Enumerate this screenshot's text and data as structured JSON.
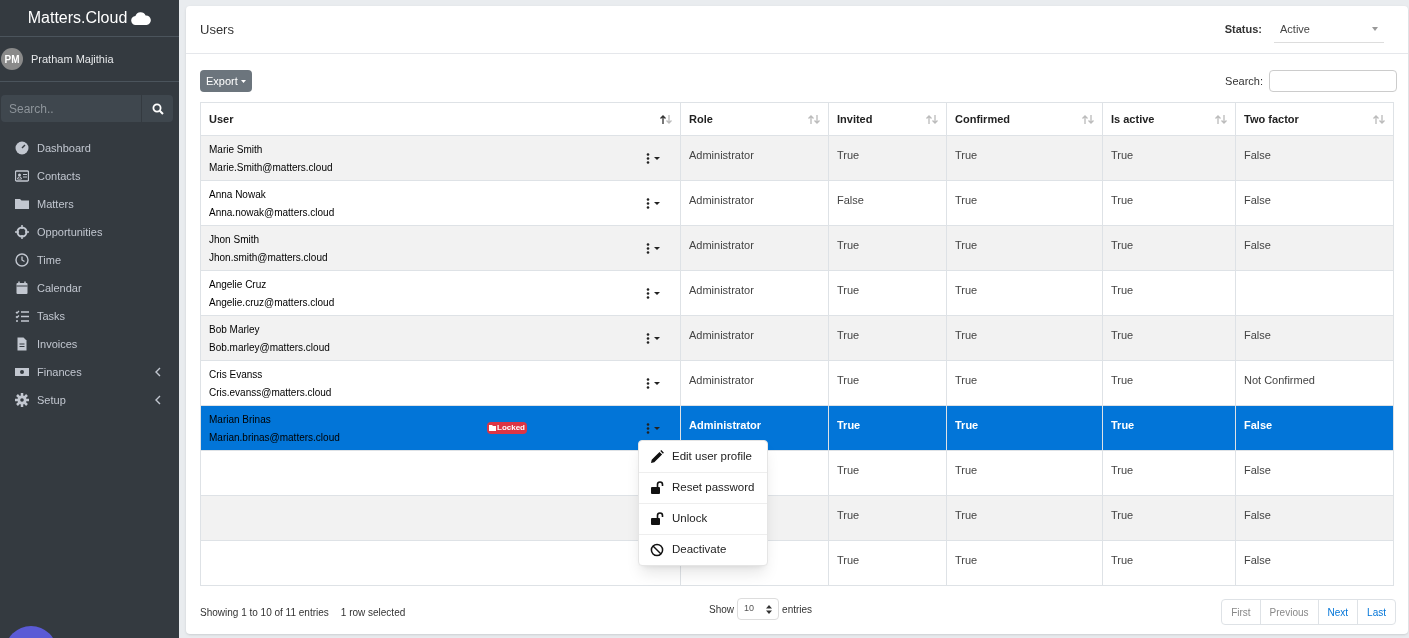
{
  "sidebar": {
    "brand": "Matters.Cloud",
    "user": {
      "initials": "PM",
      "name": "Pratham Majithia"
    },
    "search": {
      "placeholder": "Search.."
    },
    "items": [
      {
        "label": "Dashboard",
        "has_submenu": false
      },
      {
        "label": "Contacts",
        "has_submenu": false
      },
      {
        "label": "Matters",
        "has_submenu": false
      },
      {
        "label": "Opportunities",
        "has_submenu": false
      },
      {
        "label": "Time",
        "has_submenu": false
      },
      {
        "label": "Calendar",
        "has_submenu": false
      },
      {
        "label": "Tasks",
        "has_submenu": false
      },
      {
        "label": "Invoices",
        "has_submenu": false
      },
      {
        "label": "Finances",
        "has_submenu": true
      },
      {
        "label": "Setup",
        "has_submenu": true
      }
    ]
  },
  "page": {
    "title": "Users",
    "status_filter": {
      "label": "Status:",
      "value": "Active"
    },
    "export_button": "Export",
    "search_label": "Search:"
  },
  "table": {
    "columns": [
      {
        "label": "User",
        "sorted": true
      },
      {
        "label": "Role",
        "sorted": false
      },
      {
        "label": "Invited",
        "sorted": false
      },
      {
        "label": "Confirmed",
        "sorted": false
      },
      {
        "label": "Is active",
        "sorted": false
      },
      {
        "label": "Two factor",
        "sorted": false
      }
    ],
    "rows": [
      {
        "name": "Marie Smith",
        "email": "Marie.Smith@matters.cloud",
        "role": "Administrator",
        "invited": "True",
        "confirmed": "True",
        "is_active": "True",
        "two_factor": "False",
        "selected": false
      },
      {
        "name": "Anna Nowak",
        "email": "Anna.nowak@matters.cloud",
        "role": "Administrator",
        "invited": "False",
        "confirmed": "True",
        "is_active": "True",
        "two_factor": "False",
        "selected": false
      },
      {
        "name": "Jhon Smith",
        "email": "Jhon.smith@matters.cloud",
        "role": "Administrator",
        "invited": "True",
        "confirmed": "True",
        "is_active": "True",
        "two_factor": "False",
        "selected": false
      },
      {
        "name": "Angelie Cruz",
        "email": "Angelie.cruz@matters.cloud",
        "role": "Administrator",
        "invited": "True",
        "confirmed": "True",
        "is_active": "True",
        "selected": false
      },
      {
        "name": "Bob Marley",
        "email": "Bob.marley@matters.cloud",
        "role": "Administrator",
        "invited": "True",
        "confirmed": "True",
        "is_active": "True",
        "two_factor": "False",
        "selected": false
      },
      {
        "name": "Cris Evanss",
        "email": "Cris.evanss@matters.cloud",
        "role": "Administrator",
        "invited": "True",
        "confirmed": "True",
        "is_active": "True",
        "two_factor": "Not Confirmed",
        "selected": false
      },
      {
        "name": "Marian Brinas",
        "email": "Marian.brinas@matters.cloud",
        "badge": "Locked",
        "role": "Administrator",
        "invited": "True",
        "confirmed": "True",
        "is_active": "True",
        "two_factor": "False",
        "selected": true
      },
      {
        "invited": "True",
        "confirmed": "True",
        "is_active": "True",
        "two_factor": "False",
        "selected": false
      },
      {
        "invited": "True",
        "confirmed": "True",
        "is_active": "True",
        "two_factor": "False",
        "selected": false
      },
      {
        "invited": "True",
        "confirmed": "True",
        "is_active": "True",
        "two_factor": "False",
        "selected": false
      }
    ]
  },
  "context_menu": {
    "items": [
      {
        "label": "Edit user profile"
      },
      {
        "label": "Reset password"
      },
      {
        "label": "Unlock"
      },
      {
        "label": "Deactivate"
      }
    ]
  },
  "footer": {
    "info": "Showing 1 to 10 of 11 entries",
    "selection": "1 row selected",
    "show_label": "Show",
    "page_size": "10",
    "entries_label": "entries",
    "pagination": [
      {
        "label": "First",
        "disabled": true
      },
      {
        "label": "Previous",
        "disabled": true
      },
      {
        "label": "Next",
        "disabled": false
      },
      {
        "label": "Last",
        "disabled": false
      }
    ]
  }
}
